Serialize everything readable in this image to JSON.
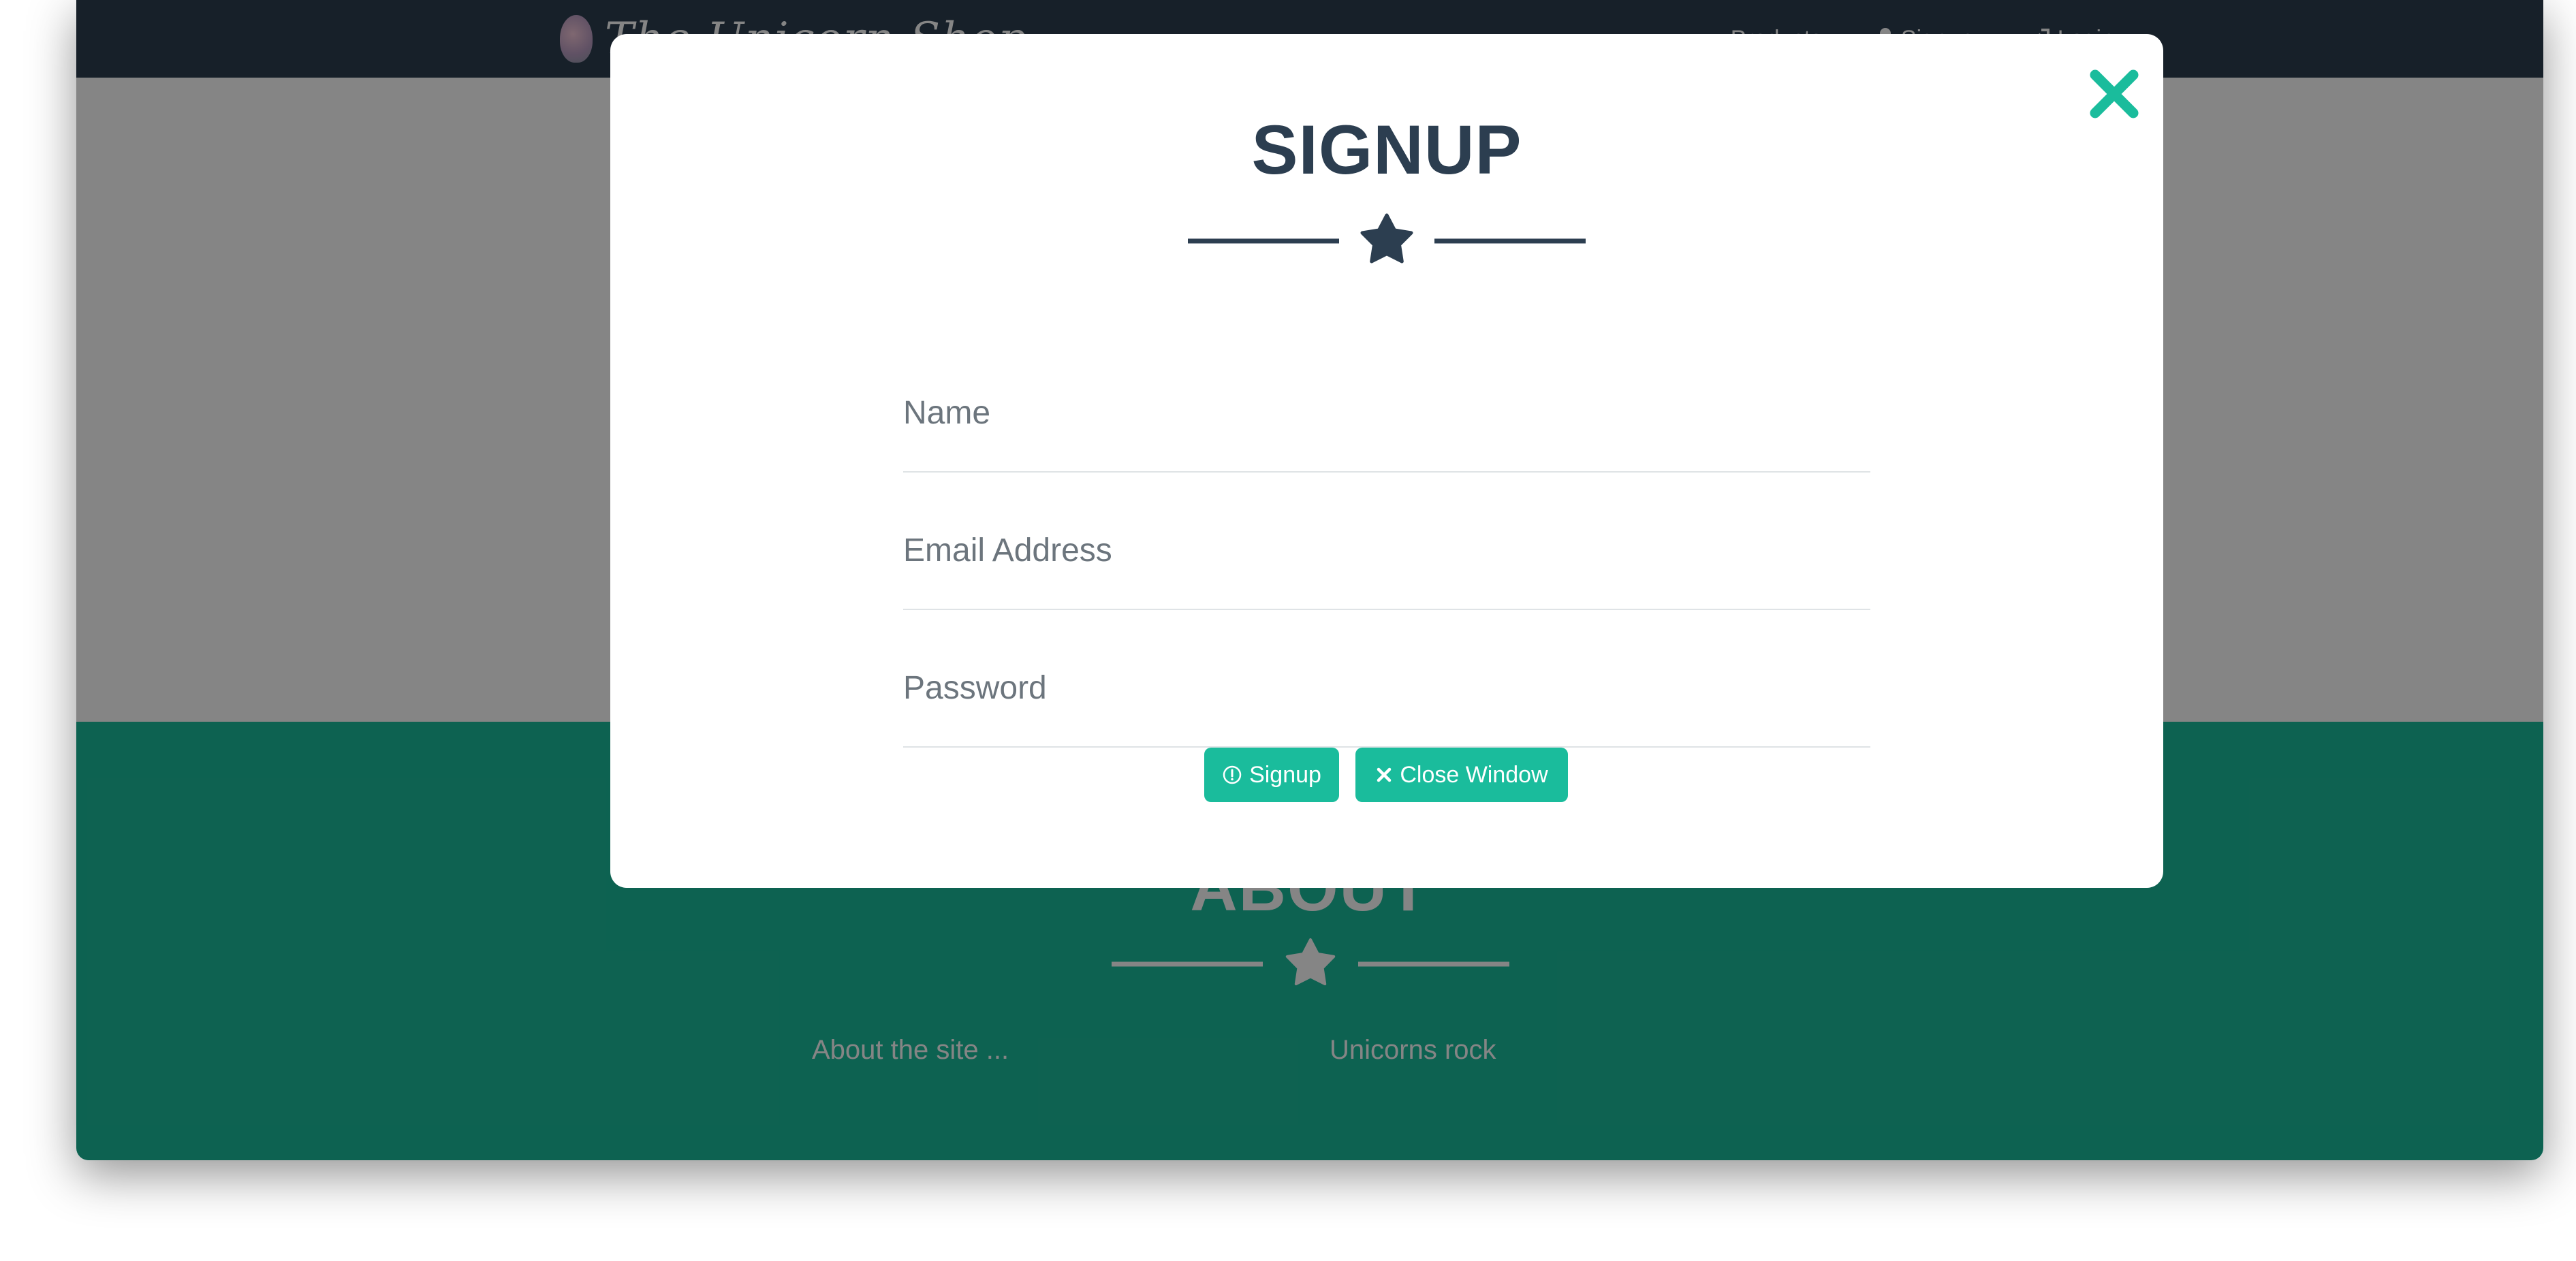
{
  "navbar": {
    "brand": "The Unicorn Shop",
    "links": [
      {
        "label": "Products",
        "icon": "none"
      },
      {
        "label": "Signup",
        "icon": "user-icon"
      },
      {
        "label": "Login",
        "icon": "login-icon"
      }
    ],
    "background": "#2c3e50"
  },
  "about": {
    "title": "ABOUT",
    "left_text": "About the site ...",
    "right_text": "Unicorns rock",
    "background": "#1abc9c"
  },
  "modal": {
    "title": "SIGNUP",
    "fields": {
      "name": {
        "placeholder": "Name",
        "value": ""
      },
      "email": {
        "placeholder": "Email Address",
        "value": ""
      },
      "password": {
        "placeholder": "Password",
        "value": ""
      }
    },
    "buttons": {
      "signup_label": "Signup",
      "close_label": "Close Window"
    },
    "icons": {
      "close": "close-x-icon",
      "divider": "star-icon",
      "signup": "info-circle-icon",
      "close_button": "times-icon"
    },
    "colors": {
      "title": "#2c3e50",
      "accent": "#1abc9c",
      "overlay": "rgba(0,0,0,0.48)"
    }
  }
}
